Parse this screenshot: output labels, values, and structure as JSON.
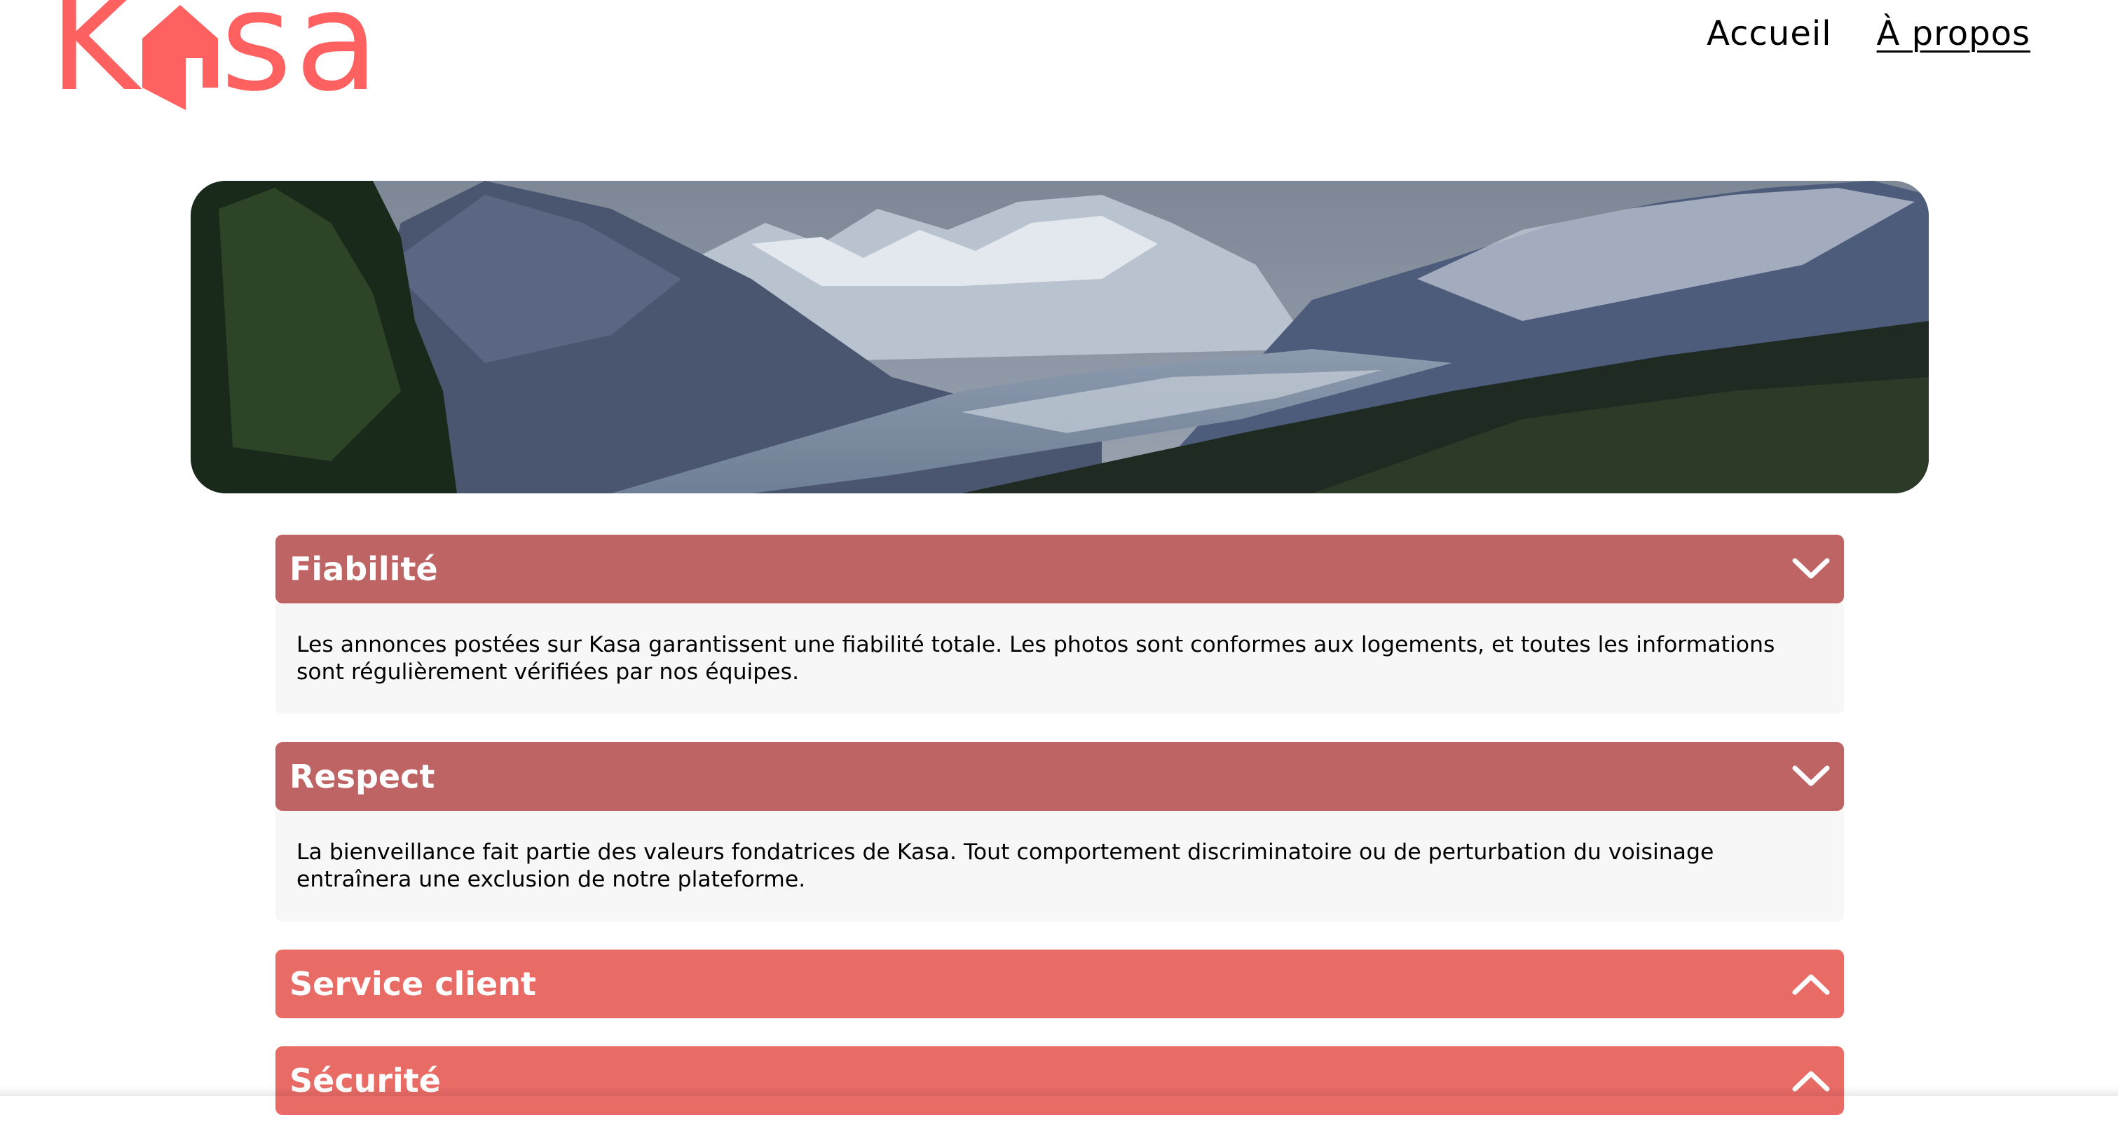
{
  "brand": {
    "logo_letters": [
      "K",
      "sa"
    ],
    "logo_icon": "house-icon",
    "accent_color": "#FF6060"
  },
  "nav": {
    "items": [
      {
        "label": "Accueil",
        "active": false
      },
      {
        "label": "À propos",
        "active": true
      }
    ]
  },
  "banner": {
    "image": "mountain-valley-landscape"
  },
  "collapses": [
    {
      "title": "Fiabilité",
      "open": true,
      "icon": "chevron-down-icon",
      "content": "Les annonces postées sur Kasa garantissent une fiabilité totale. Les photos sont conformes aux logements, et toutes les informations sont régulièrement vérifiées par nos équipes."
    },
    {
      "title": "Respect",
      "open": true,
      "icon": "chevron-down-icon",
      "content": "La bienveillance fait partie des valeurs fondatrices de Kasa. Tout comportement discriminatoire ou de perturbation du voisinage entraînera une exclusion de notre plateforme."
    },
    {
      "title": "Service client",
      "open": false,
      "icon": "chevron-up-icon"
    },
    {
      "title": "Sécurité",
      "open": false,
      "icon": "chevron-up-icon"
    }
  ],
  "colors": {
    "open_header": "#BF6464",
    "closed_header": "#E96B66",
    "body_background": "#F7F7F7"
  }
}
